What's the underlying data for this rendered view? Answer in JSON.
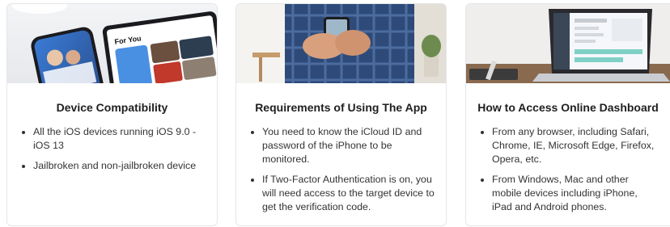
{
  "cards": [
    {
      "image": "phones-and-tablet-app-screens",
      "title": "Device Compatibility",
      "bullets": [
        "All the iOS devices running iOS 9.0 - iOS 13",
        "Jailbroken and non-jailbroken device"
      ]
    },
    {
      "image": "hands-holding-smartphone",
      "title": "Requirements of Using The App",
      "bullets": [
        "You need to know the iCloud ID and password of the iPhone to be monitored.",
        "If Two-Factor Authentication is on, you will need access to the target device to get the verification code."
      ]
    },
    {
      "image": "laptop-showing-dashboard",
      "title": "How to Access Online Dashboard",
      "bullets": [
        "From any browser, including Safari, Chrome, IE, Microsoft Edge, Firefox, Opera, etc.",
        "From Windows, Mac and other mobile devices including iPhone, iPad and Android phones."
      ]
    }
  ],
  "colors": {
    "card_border": "#e3e6ea",
    "title": "#1f1f1f",
    "body": "#333333"
  }
}
